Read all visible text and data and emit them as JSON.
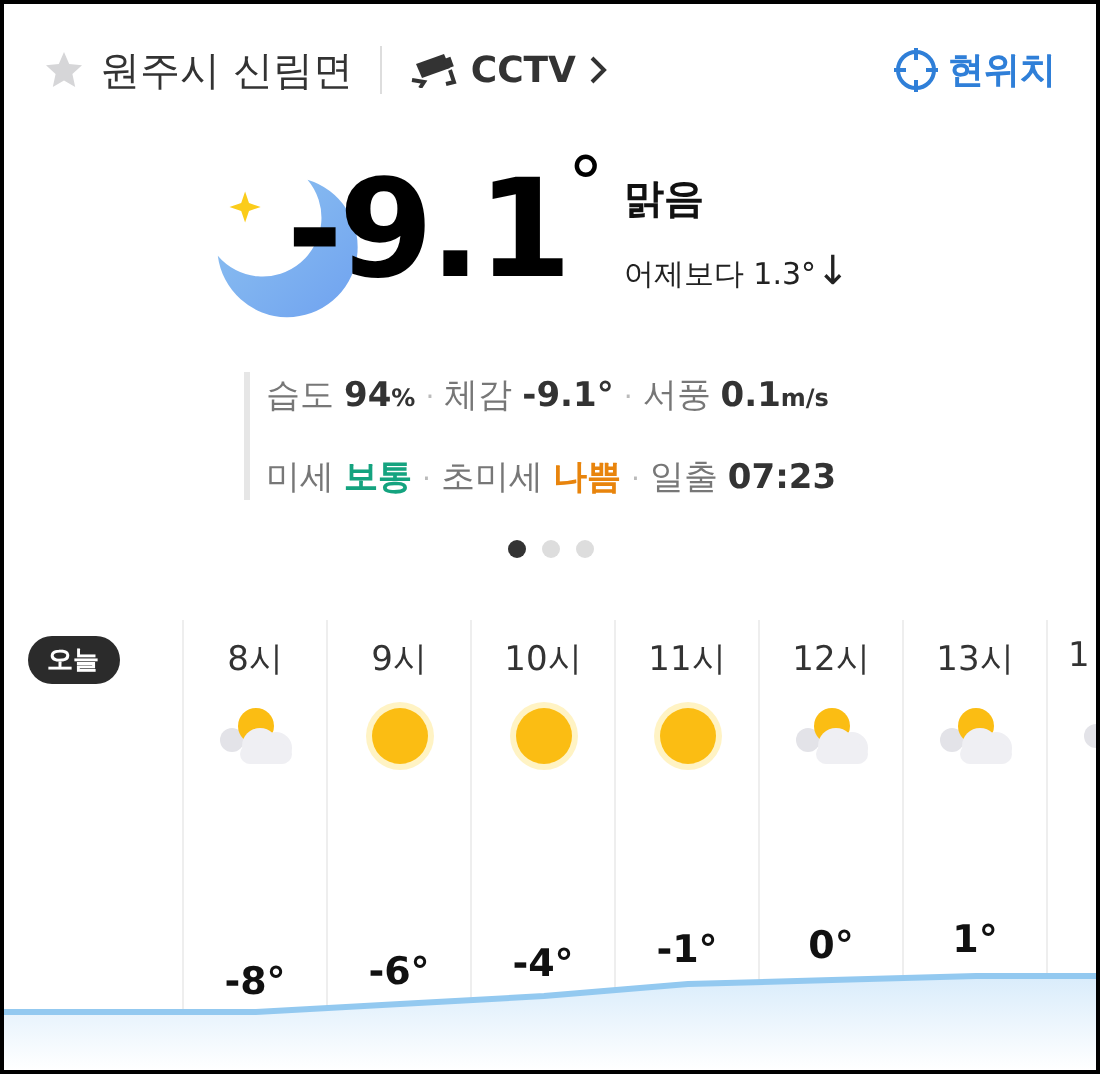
{
  "header": {
    "location": "원주시 신림면",
    "favorite": false,
    "cctv_label": "CCTV",
    "current_location": "현위치"
  },
  "current": {
    "kind": "moon",
    "temperature": "-9.1",
    "degree": "°",
    "condition": "맑음",
    "compare": "어제보다 1.3°",
    "trend": "↓"
  },
  "details": [
    [
      {
        "label": "습도",
        "value": "94",
        "unit": "%"
      },
      {
        "separator": "·",
        "label": "체감",
        "value": "-9.1°"
      },
      {
        "separator": "·",
        "label": "서풍",
        "value": "0.1",
        "unit": "m/s"
      }
    ],
    [
      {
        "label": "미세",
        "value": "보통",
        "color": "#14a37f"
      },
      {
        "separator": "·",
        "label": "초미세",
        "value": "나쁨",
        "color": "#e8840c"
      },
      {
        "separator": "·",
        "label": "일출",
        "value": "07:23"
      }
    ]
  ],
  "pager": [
    {
      "selected": true
    },
    {
      "selected": false
    },
    {
      "selected": false
    }
  ],
  "hourly": {
    "today_badge": "오늘",
    "hours": [
      {
        "label": "8시",
        "kind": "cloud-sun",
        "temp": "-8°"
      },
      {
        "label": "9시",
        "kind": "sun",
        "temp": "-6°"
      },
      {
        "label": "10시",
        "kind": "sun",
        "temp": "-4°"
      },
      {
        "label": "11시",
        "kind": "sun",
        "temp": "-1°"
      },
      {
        "label": "12시",
        "kind": "cloud-sun",
        "temp": "0°"
      },
      {
        "label": "13시",
        "kind": "cloud-sun",
        "temp": "1°"
      },
      {
        "label": "1",
        "kind": "cloud-sun"
      }
    ]
  }
}
